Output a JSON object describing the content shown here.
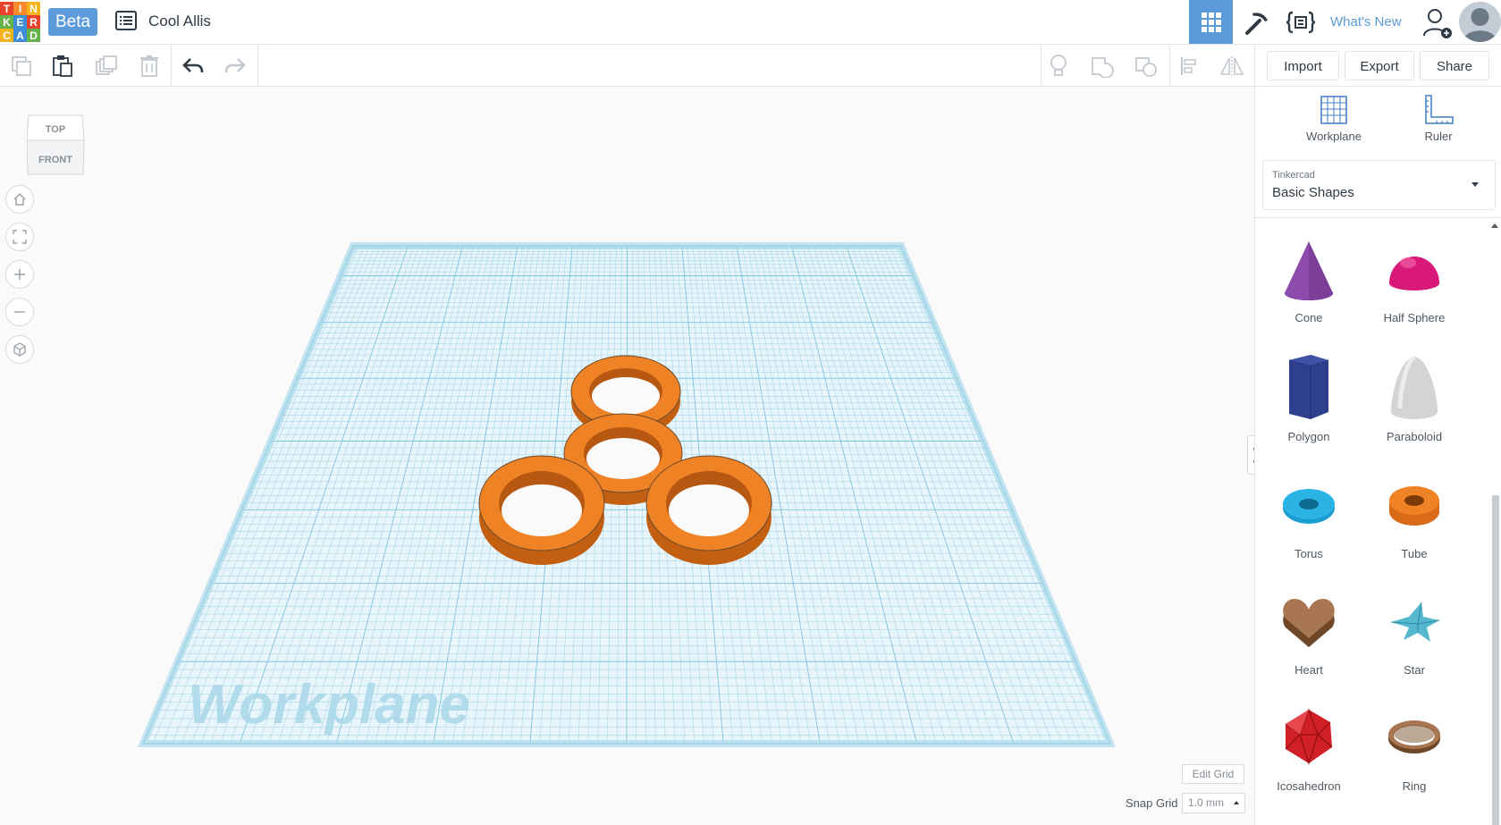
{
  "header": {
    "logo_letters": [
      "T",
      "I",
      "N",
      "K",
      "E",
      "R",
      "C",
      "A",
      "D"
    ],
    "logo_colors": [
      "#e8412c",
      "#f7892b",
      "#f5b31c",
      "#63b24a",
      "#3e8dd9",
      "#e8412c",
      "#f5b31c",
      "#3e8dd9",
      "#63b24a"
    ],
    "beta_label": "Beta",
    "design_name": "Cool Allis",
    "whats_new_label": "What's New"
  },
  "toolbar": {
    "import_label": "Import",
    "export_label": "Export",
    "share_label": "Share"
  },
  "canvas": {
    "viewcube": {
      "top_label": "TOP",
      "front_label": "FRONT"
    },
    "workplane_label": "Workplane",
    "edit_grid_label": "Edit Grid",
    "snap_grid_label": "Snap Grid",
    "snap_grid_value": "1.0 mm",
    "shape_color": "#f07f1e",
    "grid_color": "#7ec4de"
  },
  "panel": {
    "workplane_label": "Workplane",
    "ruler_label": "Ruler",
    "library_category": "Tinkercad",
    "library_name": "Basic Shapes",
    "shapes": [
      {
        "name": "Cone",
        "icon": "cone-icon",
        "color": "#7b3f98"
      },
      {
        "name": "Half Sphere",
        "icon": "half-sphere-icon",
        "color": "#d9197a"
      },
      {
        "name": "Polygon",
        "icon": "polygon-icon",
        "color": "#2e3f8e"
      },
      {
        "name": "Paraboloid",
        "icon": "paraboloid-icon",
        "color": "#d8d8d8"
      },
      {
        "name": "Torus",
        "icon": "torus-icon",
        "color": "#1b9dd1"
      },
      {
        "name": "Tube",
        "icon": "tube-icon",
        "color": "#e8771e"
      },
      {
        "name": "Heart",
        "icon": "heart-icon",
        "color": "#8b5a36"
      },
      {
        "name": "Star",
        "icon": "star-icon",
        "color": "#55b8cf"
      },
      {
        "name": "Icosahedron",
        "icon": "icosahedron-icon",
        "color": "#d01f25"
      },
      {
        "name": "Ring",
        "icon": "ring-icon",
        "color": "#8b5a36"
      }
    ]
  }
}
